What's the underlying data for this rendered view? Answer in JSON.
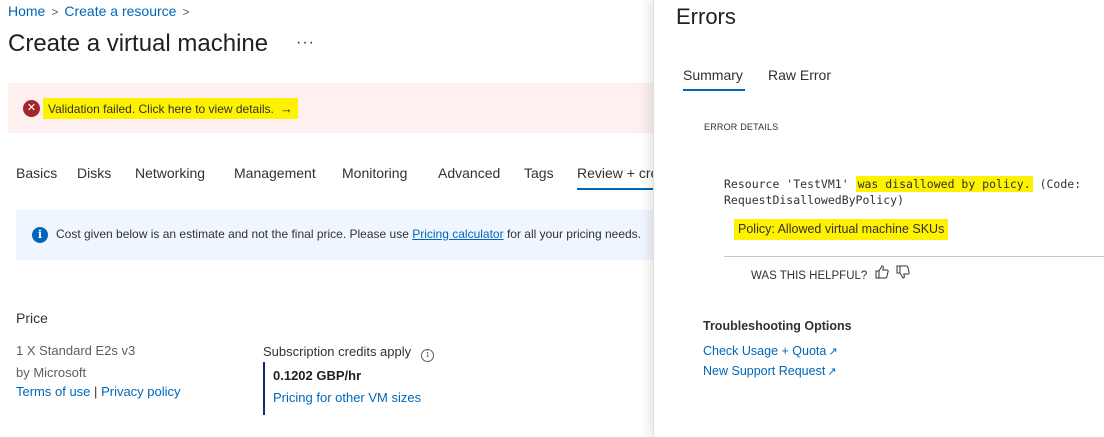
{
  "breadcrumb": {
    "home": "Home",
    "create_resource": "Create a resource",
    "sep": ">"
  },
  "page": {
    "title": "Create a virtual machine",
    "more": "···"
  },
  "validation": {
    "message": "Validation failed. Click here to view details.",
    "arrow": "→",
    "icon": "error-x-icon"
  },
  "tabs": [
    "Basics",
    "Disks",
    "Networking",
    "Management",
    "Monitoring",
    "Advanced",
    "Tags",
    "Review + cre"
  ],
  "info": {
    "text_before": "Cost given below is an estimate and not the final price. Please use",
    "link": "Pricing calculator",
    "text_after": "for all your pricing needs."
  },
  "price": {
    "heading": "Price",
    "sku": "1 X Standard E2s v3",
    "by": "by Microsoft",
    "terms": "Terms of use",
    "sep": "|",
    "privacy": "Privacy policy",
    "credits": "Subscription credits apply",
    "rate": "0.1202 GBP/hr",
    "other_sizes": "Pricing for other VM sizes"
  },
  "errors_panel": {
    "title": "Errors",
    "tabs": [
      "Summary",
      "Raw Error"
    ],
    "active_tab": "Summary",
    "section_label": "ERROR DETAILS",
    "detail_line1_before": "Resource 'TestVM1' ",
    "detail_line1_highlight": "was disallowed by policy.",
    "detail_line1_after": " (Code:",
    "detail_line2": "RequestDisallowedByPolicy)",
    "policy": "Policy: Allowed virtual machine SKUs",
    "helpful": "WAS THIS HELPFUL?",
    "troubleshooting_title": "Troubleshooting Options",
    "links": [
      "Check Usage + Quota",
      "New Support Request"
    ]
  },
  "colors": {
    "accent": "#0067b8",
    "error": "#a4262c",
    "highlight": "#fff200",
    "error_bg": "#fdf0ef",
    "info_bg": "#f0f6ff"
  }
}
